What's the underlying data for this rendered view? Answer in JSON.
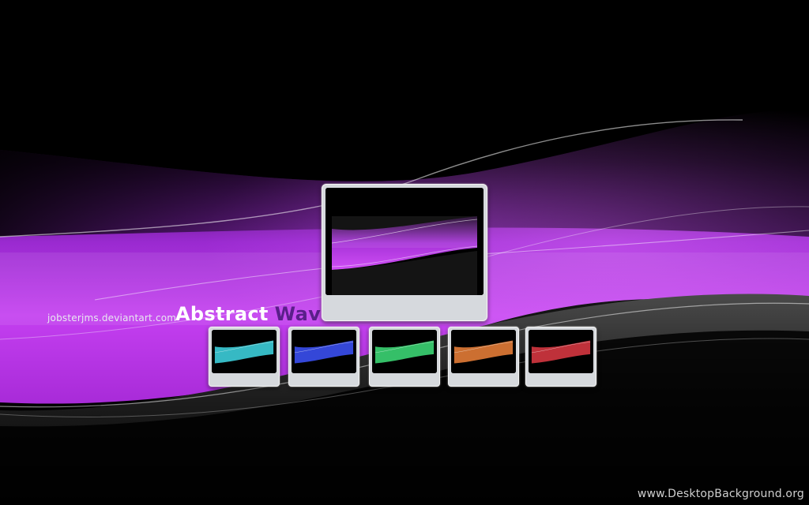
{
  "wallpaper": {
    "credit": "jobsterjms.deviantart.com",
    "title_part1": "Abstract",
    "title_part2": "Wave",
    "watermark": "www.DesktopBackground.org",
    "accent_color": "#c23cf0"
  },
  "thumbnails": [
    {
      "name": "cyan",
      "color": "#3fd9e6"
    },
    {
      "name": "blue",
      "color": "#3a4ff0"
    },
    {
      "name": "green",
      "color": "#3ee07a"
    },
    {
      "name": "orange",
      "color": "#f0823a"
    },
    {
      "name": "red",
      "color": "#e03a44"
    }
  ]
}
